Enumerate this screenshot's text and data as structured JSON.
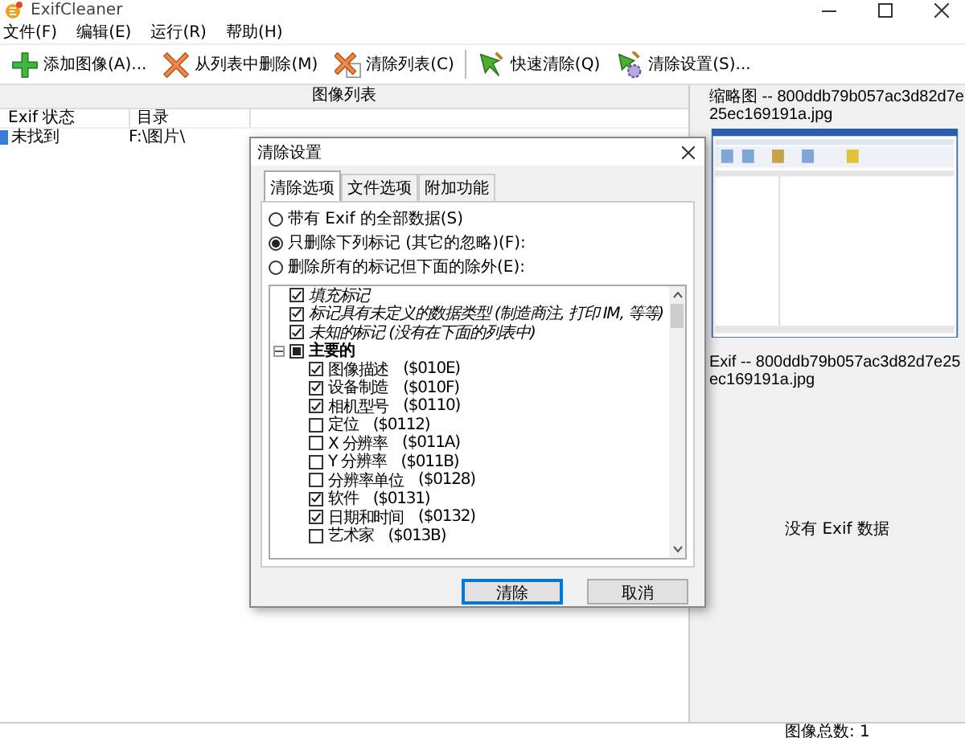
{
  "window": {
    "title": "ExifCleaner"
  },
  "menu": [
    {
      "label": "文件(F)"
    },
    {
      "label": "编辑(E)"
    },
    {
      "label": "运行(R)"
    },
    {
      "label": "帮助(H)"
    }
  ],
  "toolbar": [
    {
      "label": "添加图像(A)...",
      "kind": "add"
    },
    {
      "label": "从列表中删除(M)",
      "kind": "remove"
    },
    {
      "label": "清除列表(C)",
      "kind": "clear"
    },
    {
      "label": "快速清除(Q)",
      "kind": "quick"
    },
    {
      "label": "清除设置(S)...",
      "kind": "settings"
    }
  ],
  "image_list": {
    "header": "图像列表",
    "columns": [
      "Exif 状态",
      "目录"
    ],
    "rows": [
      {
        "status": "未找到",
        "directory": "F:\\图片\\"
      }
    ]
  },
  "preview": {
    "thumbnail_title": "缩略图 -- 800ddb79b057ac3d82d7e25ec169191a.jpg",
    "exif_title": "Exif -- 800ddb79b057ac3d82d7e25ec169191a.jpg",
    "exif_message": "没有 Exif 数据"
  },
  "status_bar": {
    "text": "图像总数: 1"
  },
  "dialog": {
    "title": "清除设置",
    "tabs": [
      {
        "label": "清除选项",
        "selected": true
      },
      {
        "label": "文件选项",
        "selected": false
      },
      {
        "label": "附加功能",
        "selected": false
      }
    ],
    "options": [
      {
        "label": "带有 Exif 的全部数据(S)",
        "selected": false
      },
      {
        "label": "只删除下列标记 (其它的忽略)(F):",
        "selected": true
      },
      {
        "label": "删除所有的标记但下面的除外(E):",
        "selected": false
      }
    ],
    "tree": [
      {
        "kind": "flag",
        "label": "填充标记",
        "checked": true
      },
      {
        "kind": "flag",
        "label": "标记具有未定义的数据类型 (制造商注, 打印 IM, 等等)",
        "checked": true
      },
      {
        "kind": "flag",
        "label": "未知的标记 (没有在下面的列表中)",
        "checked": true
      },
      {
        "kind": "group",
        "label": "主要的",
        "indeterminate": true,
        "expanded": true,
        "children": [
          {
            "label": "图像描述",
            "code": "($010E)",
            "checked": true
          },
          {
            "label": "设备制造",
            "code": "($010F)",
            "checked": true
          },
          {
            "label": "相机型号",
            "code": "($0110)",
            "checked": true
          },
          {
            "label": "定位",
            "code": "($0112)",
            "checked": false
          },
          {
            "label": "X 分辨率",
            "code": "($011A)",
            "checked": false
          },
          {
            "label": "Y 分辨率",
            "code": "($011B)",
            "checked": false
          },
          {
            "label": "分辨率单位",
            "code": "($0128)",
            "checked": false
          },
          {
            "label": "软件",
            "code": "($0131)",
            "checked": true
          },
          {
            "label": "日期和时间",
            "code": "($0132)",
            "checked": true
          },
          {
            "label": "艺术家",
            "code": "($013B)",
            "checked": false
          }
        ]
      }
    ],
    "buttons": [
      {
        "label": "清除",
        "default": true
      },
      {
        "label": "取消",
        "default": false
      }
    ]
  }
}
